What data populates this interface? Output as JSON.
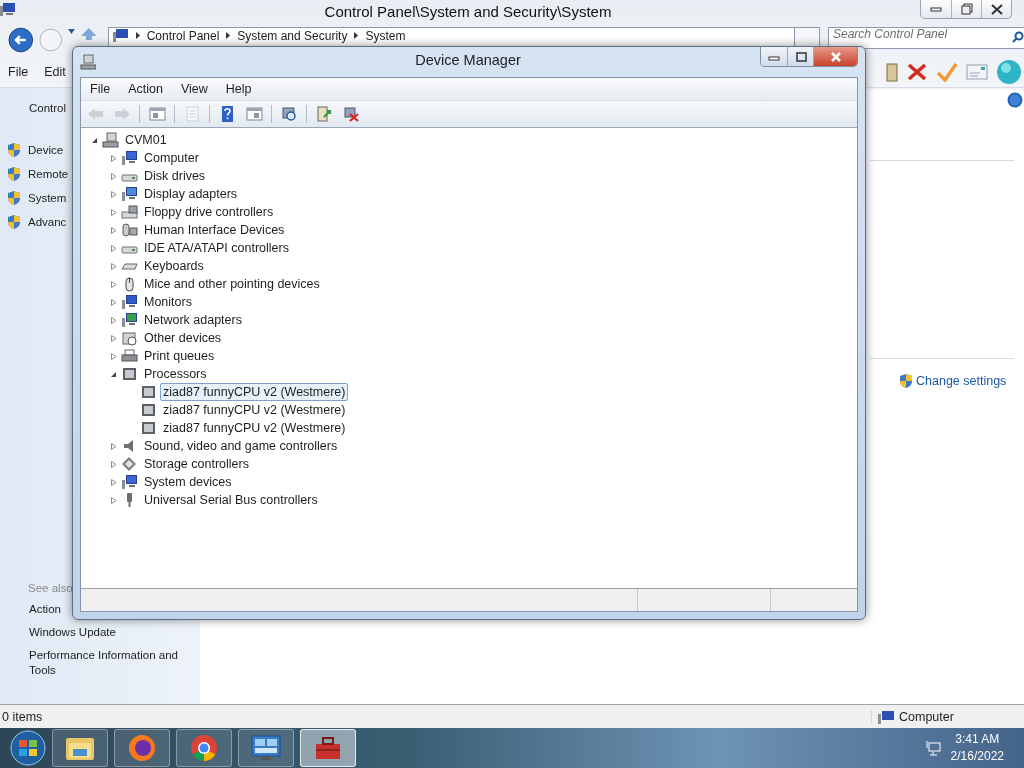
{
  "control_panel": {
    "title": "Control Panel\\System and Security\\System",
    "breadcrumb": [
      "Control Panel",
      "System and Security",
      "System"
    ],
    "search": {
      "placeholder": "Search Control Panel"
    },
    "menu": [
      "File",
      "Edit"
    ],
    "sidebar": {
      "home_link": "Control",
      "tasks": [
        "Device",
        "Remote",
        "System",
        "Advanc"
      ],
      "see_also_heading": "See also",
      "see_also": [
        "Action",
        "Windows Update",
        "Performance Information and Tools"
      ]
    },
    "change_settings": "Change settings",
    "status_bar": {
      "items": "0 items",
      "location": "Computer"
    }
  },
  "device_manager": {
    "title": "Device Manager",
    "menu": [
      "File",
      "Action",
      "View",
      "Help"
    ],
    "toolbar": [
      {
        "kind": "back",
        "disabled": true
      },
      {
        "kind": "forward",
        "disabled": true
      },
      {
        "kind": "tree-pane",
        "disabled": false
      },
      {
        "kind": "properties",
        "disabled": true
      },
      {
        "kind": "help",
        "disabled": false
      },
      {
        "kind": "action-pane",
        "disabled": false
      },
      {
        "kind": "scan",
        "disabled": false
      },
      {
        "kind": "update",
        "disabled": false
      },
      {
        "kind": "uninstall",
        "disabled": false
      }
    ],
    "tree": {
      "label": "CVM01",
      "expanded": true,
      "selected": false,
      "children": [
        {
          "label": "Computer",
          "expanded": false,
          "selected": false
        },
        {
          "label": "Disk drives",
          "expanded": false,
          "selected": false
        },
        {
          "label": "Display adapters",
          "expanded": false,
          "selected": false
        },
        {
          "label": "Floppy drive controllers",
          "expanded": false,
          "selected": false
        },
        {
          "label": "Human Interface Devices",
          "expanded": false,
          "selected": false
        },
        {
          "label": "IDE ATA/ATAPI controllers",
          "expanded": false,
          "selected": false
        },
        {
          "label": "Keyboards",
          "expanded": false,
          "selected": false
        },
        {
          "label": "Mice and other pointing devices",
          "expanded": false,
          "selected": false
        },
        {
          "label": "Monitors",
          "expanded": false,
          "selected": false
        },
        {
          "label": "Network adapters",
          "expanded": false,
          "selected": false
        },
        {
          "label": "Other devices",
          "expanded": false,
          "selected": false
        },
        {
          "label": "Print queues",
          "expanded": false,
          "selected": false
        },
        {
          "label": "Processors",
          "expanded": true,
          "selected": false,
          "children": [
            {
              "label": "ziad87 funnyCPU v2 (Westmere)",
              "selected": true
            },
            {
              "label": "ziad87 funnyCPU v2 (Westmere)",
              "selected": false
            },
            {
              "label": "ziad87 funnyCPU v2 (Westmere)",
              "selected": false
            }
          ]
        },
        {
          "label": "Sound, video and game controllers",
          "expanded": false,
          "selected": false
        },
        {
          "label": "Storage controllers",
          "expanded": false,
          "selected": false
        },
        {
          "label": "System devices",
          "expanded": false,
          "selected": false
        },
        {
          "label": "Universal Serial Bus controllers",
          "expanded": false,
          "selected": false
        }
      ]
    }
  },
  "taskbar": {
    "apps": [
      {
        "kind": "folder",
        "active": false
      },
      {
        "kind": "firefox",
        "active": false
      },
      {
        "kind": "chrome",
        "active": false
      },
      {
        "kind": "control-panel",
        "active": false
      },
      {
        "kind": "toolbox",
        "active": true
      }
    ],
    "clock": {
      "time": "3:41 AM",
      "date": "2/16/2022"
    }
  }
}
